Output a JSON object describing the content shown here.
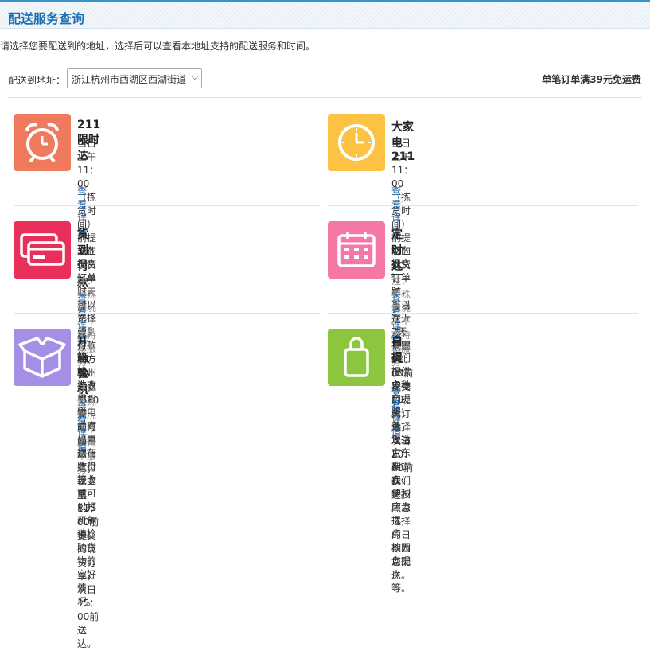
{
  "page_title": "配送服务查询",
  "intro": "请选择您要配送到的地址，选择后可以查看本地址支持的配送服务和时间。",
  "address": {
    "label": "配送到地址：",
    "value": "浙江杭州市西湖区西湖街道"
  },
  "free_shipping": "单笔订单满39元免运费",
  "details_label": "查看详情",
  "colors": {
    "accent": "#1f6fb0",
    "link": "#1a5ea0",
    "note": "#999999"
  },
  "services": [
    {
      "title": "211限时达",
      "icon": "alarm-clock-icon",
      "color": "#f07a5e",
      "desc": [
        "当日上午11：00（拣货时间）前提交的现货订单（天",
        "津、东莞、深圳、杭州为上午10点前），当日送达；夜",
        "里11：00前提交的现货订单，次日15：00前送达。"
      ],
      "note": ""
    },
    {
      "title": "大家电211",
      "icon": "clock-icon",
      "color": "#fbc244",
      "desc": [
        "当日上午11：00（拣货时间）前提交的现货订单，当日",
        "送达；夜里11：00前提交的现货订单，次日20：00前送",
        "达。"
      ],
      "note": ""
    },
    {
      "title": "货到付款",
      "icon": "card-payment-icon",
      "color": "#e8305a",
      "desc": [
        "您在提交订单时，可以选择货到付款的方式，在收到货物",
        "的时候再进行支付现金或POS机刷卡。"
      ],
      "note": "注：特殊情况下不支持本服务"
    },
    {
      "title": "定时达",
      "icon": "calendar-icon",
      "color": "#f577a6",
      "desc": [
        "您在提交订单时，可以在近7天范围内(大家电10天)选择",
        "送达日期，我们将按照您选择的日期为您配送。"
      ],
      "note": "注：特殊情况下不支持本服务"
    },
    {
      "title": "开箱验机",
      "icon": "open-box-icon",
      "color": "#a58ee6",
      "desc": [
        "冰箱、洗衣机、彩电类商品，您在收货签收前可以打开包",
        "装检验货物的完好情况。"
      ],
      "note": "注：特殊情况下不支持本服务"
    },
    {
      "title": "自提",
      "icon": "shopping-bag-icon",
      "color": "#8cc63e",
      "desc": [
        "我们提供多种自提服务，包括京东自提点、便利店自提",
        "点、校园自提点等。"
      ],
      "note": ""
    }
  ]
}
